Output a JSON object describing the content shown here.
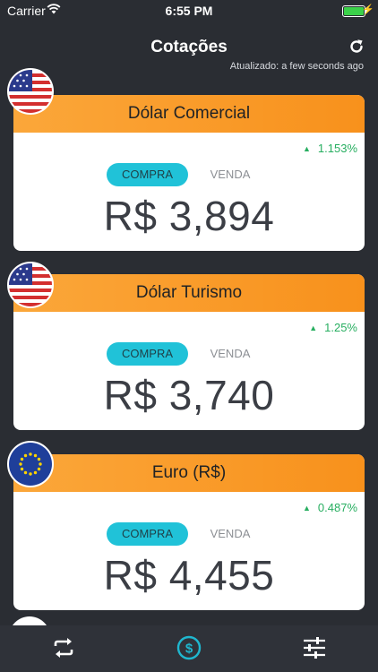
{
  "status_bar": {
    "carrier": "Carrier",
    "time": "6:55 PM",
    "battery_color": "#3bd14a"
  },
  "header": {
    "title": "Cotações",
    "refresh_icon": "refresh-icon",
    "updated": "Atualizado: a few seconds ago"
  },
  "colors": {
    "header_gradient_start": "#fba73a",
    "header_gradient_end": "#f8911c",
    "compra_button": "#20c2d8",
    "positive_change": "#27ae60",
    "background": "#2a2d33",
    "active_tab": "#1fb7cf"
  },
  "cards": [
    {
      "flag": "us-flag",
      "title": "Dólar Comercial",
      "change": "1.153%",
      "change_direction": "up",
      "compra_label": "COMPRA",
      "venda_label": "VENDA",
      "selected": "COMPRA",
      "price": "R$ 3,894"
    },
    {
      "flag": "us-flag",
      "title": "Dólar Turismo",
      "change": "1.25%",
      "change_direction": "up",
      "compra_label": "COMPRA",
      "venda_label": "VENDA",
      "selected": "COMPRA",
      "price": "R$ 3,740"
    },
    {
      "flag": "eu-flag",
      "title": "Euro (R$)",
      "change": "0.487%",
      "change_direction": "up",
      "compra_label": "COMPRA",
      "venda_label": "VENDA",
      "selected": "COMPRA",
      "price": "R$ 4,455"
    }
  ],
  "tab_bar": {
    "items": [
      {
        "icon": "convert-arrows-icon",
        "active": false
      },
      {
        "icon": "dollar-coin-icon",
        "active": true
      },
      {
        "icon": "sliders-icon",
        "active": false
      }
    ]
  }
}
